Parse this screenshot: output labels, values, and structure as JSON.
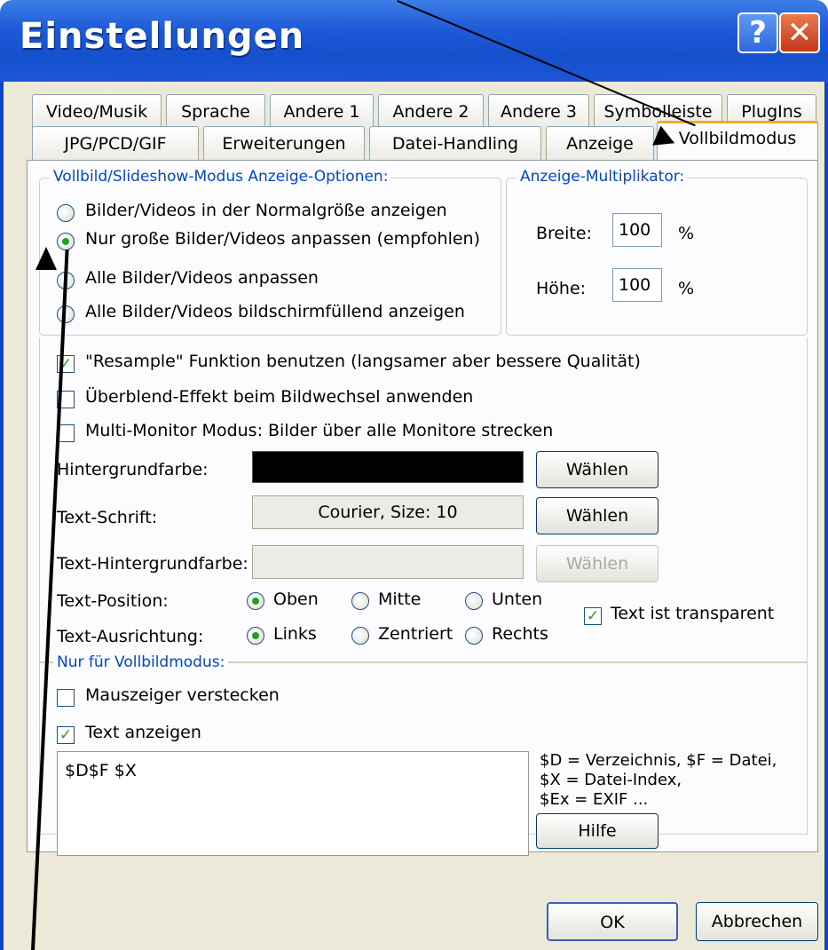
{
  "window": {
    "title": "Einstellungen",
    "help_glyph": "?",
    "close_glyph": "✕"
  },
  "tabs_row1": [
    "Video/Musik",
    "Sprache",
    "Andere 1",
    "Andere 2",
    "Andere 3",
    "Symbolleiste",
    "PlugIns"
  ],
  "tabs_row2": [
    "JPG/PCD/GIF",
    "Erweiterungen",
    "Datei-Handling",
    "Anzeige",
    "Vollbildmodus"
  ],
  "display_options": {
    "legend": "Vollbild/Slideshow-Modus Anzeige-Optionen:",
    "options": [
      "Bilder/Videos in der Normalgröße anzeigen",
      "Nur große Bilder/Videos anpassen (empfohlen)",
      "Alle Bilder/Videos anpassen",
      "Alle Bilder/Videos bildschirmfüllend anzeigen"
    ],
    "selected_index": 1
  },
  "multiplier": {
    "legend": "Anzeige-Multiplikator:",
    "width_label": "Breite:",
    "width_value": "100",
    "width_unit": "%",
    "height_label": "Höhe:",
    "height_value": "100",
    "height_unit": "%"
  },
  "checks": {
    "resample": "\"Resample\" Funktion benutzen (langsamer aber bessere Qualität)",
    "resample_checked": true,
    "blend": "Überblend-Effekt beim Bildwechsel anwenden",
    "blend_checked": false,
    "multimonitor": "Multi-Monitor Modus: Bilder über alle Monitore strecken",
    "multimonitor_checked": false
  },
  "background": {
    "label": "Hintergrundfarbe:",
    "color": "#000000",
    "button": "Wählen"
  },
  "font": {
    "label": "Text-Schrift:",
    "value": "Courier, Size: 10",
    "button": "Wählen"
  },
  "text_background": {
    "label": "Text-Hintergrundfarbe:",
    "button": "Wählen"
  },
  "text_position": {
    "label": "Text-Position:",
    "options": [
      "Oben",
      "Mitte",
      "Unten"
    ],
    "selected_index": 0
  },
  "text_alignment": {
    "label": "Text-Ausrichtung:",
    "options": [
      "Links",
      "Zentriert",
      "Rechts"
    ],
    "selected_index": 0
  },
  "transparent": {
    "label": "Text ist transparent",
    "checked": true
  },
  "fullscreen_only": {
    "legend": "Nur für Vollbildmodus:",
    "hide_cursor": "Mauszeiger verstecken",
    "hide_cursor_checked": false,
    "show_text": "Text anzeigen",
    "show_text_checked": true,
    "text_value": "$D$F $X",
    "help_lines": [
      "$D = Verzeichnis, $F = Datei,",
      "$X = Datei-Index,",
      "$Ex = EXIF ..."
    ],
    "help_button": "Hilfe"
  },
  "footer": {
    "ok": "OK",
    "cancel": "Abbrechen"
  },
  "colors": {
    "titlebar": "#1f5bd8",
    "window_bg": "#ece9d8",
    "legend": "#0046d5",
    "active_tab_accent": "#f5a623",
    "check_green": "#21a121"
  }
}
